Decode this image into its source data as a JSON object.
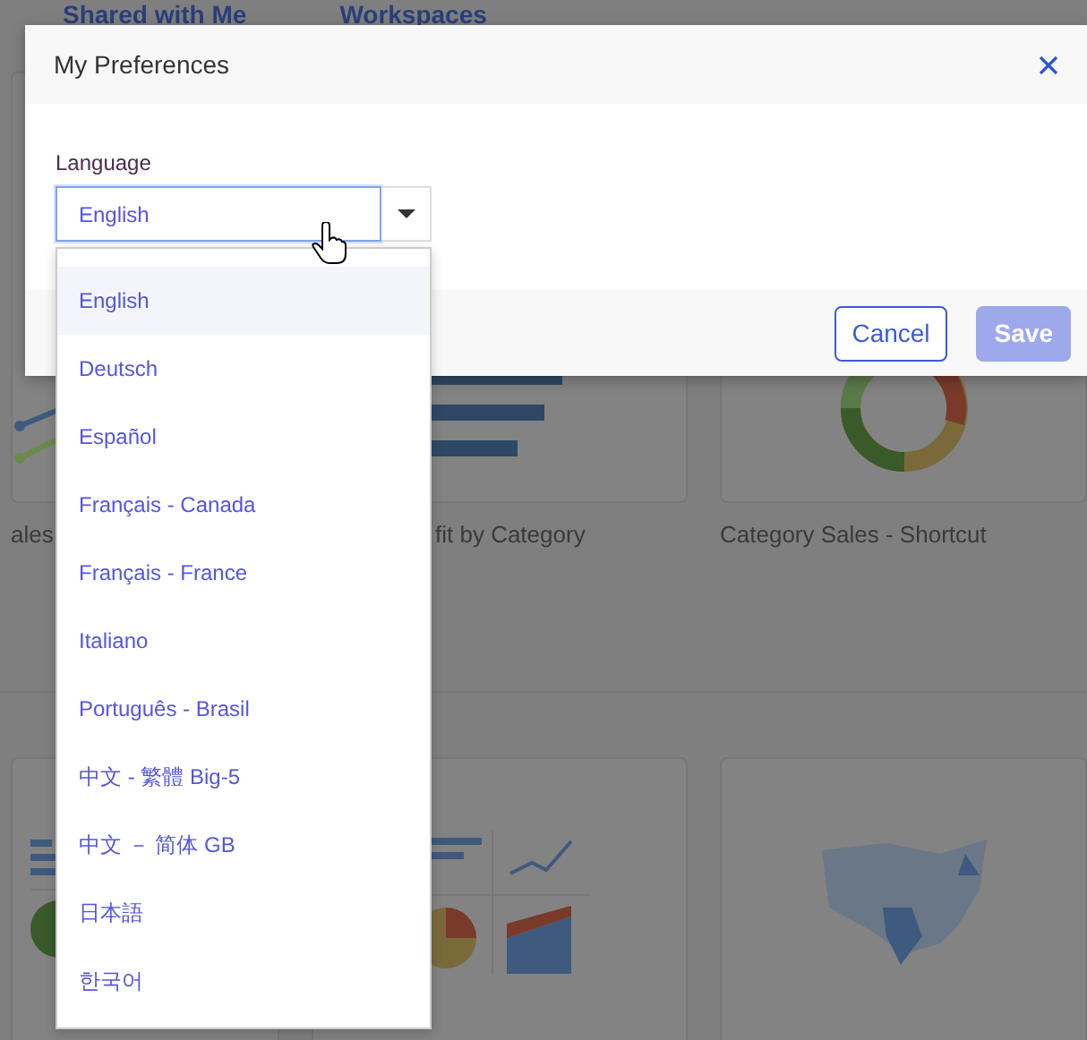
{
  "background": {
    "tabs": [
      "Shared with Me",
      "Workspaces"
    ],
    "cards": [
      {
        "kind": "line",
        "label": "ales"
      },
      {
        "kind": "bar",
        "label": "fit by Category"
      },
      {
        "kind": "donut",
        "label": "Category Sales - Shortcut"
      },
      {
        "kind": "combo"
      },
      {
        "kind": "multi"
      },
      {
        "kind": "map"
      }
    ]
  },
  "dialog": {
    "title": "My Preferences",
    "field": {
      "label": "Language",
      "value": "English",
      "expanded": true
    },
    "options": [
      {
        "label": "English",
        "selected": true
      },
      {
        "label": "Deutsch",
        "selected": false
      },
      {
        "label": "Español",
        "selected": false
      },
      {
        "label": "Français - Canada",
        "selected": false
      },
      {
        "label": "Français - France",
        "selected": false
      },
      {
        "label": "Italiano",
        "selected": false
      },
      {
        "label": "Português - Brasil",
        "selected": false
      },
      {
        "label": "中文 - 繁體 Big-5",
        "selected": false
      },
      {
        "label": "中文 －  简体 GB",
        "selected": false
      },
      {
        "label": "日本語",
        "selected": false
      },
      {
        "label": "한국어",
        "selected": false
      }
    ],
    "buttons": [
      {
        "label": "Cancel",
        "disabled": false
      },
      {
        "label": "Save",
        "disabled": true
      }
    ]
  }
}
